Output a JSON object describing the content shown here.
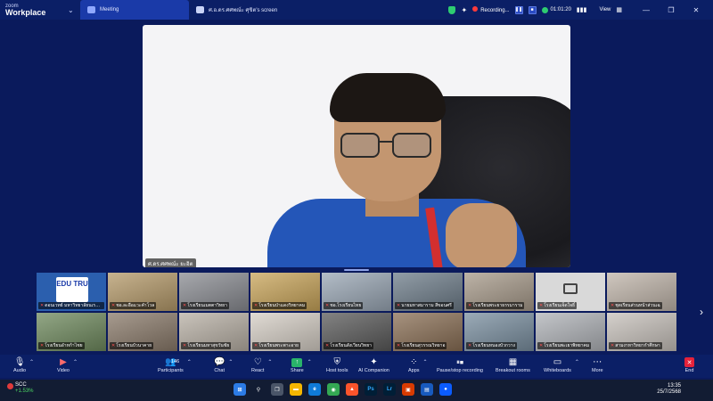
{
  "titlebar": {
    "brand_top": "zoom",
    "brand_bottom": "Workplace",
    "tabs": [
      {
        "label": "Meeting",
        "icon": "people-icon",
        "active": true
      },
      {
        "label": "ศ.อ.ดร.ศศพณ์ะ ศุขิต's screen",
        "icon": "screen-icon",
        "active": false
      }
    ],
    "recording_label": "Recording...",
    "timer": "01:01:20",
    "view_label": "View"
  },
  "shared_screen": {
    "presenter_label": "ศ.ดร.ศศพณ์ะ ยะอิต"
  },
  "gallery": {
    "tiles": [
      {
        "label": "ดอนเวทย์ มหาวิทยาลัยนเรศวร",
        "kind": "logo",
        "bg": "#2b5fae",
        "logo_text": "EDU TRU"
      },
      {
        "label": "ชอ.ละอือแวะคำโวล",
        "kind": "room",
        "bg": "#b59a6a"
      },
      {
        "label": "โรงเรียนเมตตาวิทยา",
        "kind": "room",
        "bg": "#8a8c92"
      },
      {
        "label": "โรงเรียนป่าแดงวิทยาคม",
        "kind": "room",
        "bg": "#c9a55a"
      },
      {
        "label": "ชอ.โรงเรียนไทย",
        "kind": "room",
        "bg": "#9aa7b5"
      },
      {
        "label": "นายมหาสมาราม สีขอนศรี",
        "kind": "room",
        "bg": "#6e7d8a"
      },
      {
        "label": "โรงเรียนพระยาธรรมาราม",
        "kind": "room",
        "bg": "#a79a8a"
      },
      {
        "label": "โรงเรียนเจ็ดใจธิ์",
        "kind": "camoff",
        "bg": "#d9d9d9"
      },
      {
        "label": "ชุดเรียนส่วนหน้าส่วนเฉ",
        "kind": "room",
        "bg": "#c0b5aa"
      },
      {
        "label": "โรงเรียนอำหก้าไชย",
        "kind": "room",
        "bg": "#6f8a5e"
      },
      {
        "label": "โรงเรียนบัวนาคาย",
        "kind": "room",
        "bg": "#8a7a6a"
      },
      {
        "label": "โรงเรียนมหาสุขวันชัย",
        "kind": "room",
        "bg": "#b8b0a5"
      },
      {
        "label": "โรงเรียนพระพาะอาย",
        "kind": "room",
        "bg": "#d6cfc6"
      },
      {
        "label": "โรงเรียนสังเวียนวิทยา",
        "kind": "room",
        "bg": "#5a5a5a"
      },
      {
        "label": "โรงเรียนสุวรรณวิทยาอ",
        "kind": "room",
        "bg": "#8a6f55"
      },
      {
        "label": "โรงเรียนหนองบัวกวาง",
        "kind": "room",
        "bg": "#7a8fa0"
      },
      {
        "label": "โรงเรียนพะเยาพิทยาคม",
        "kind": "room",
        "bg": "#b0b3b8"
      },
      {
        "label": "สามงาหาวิทยากำศึกษา",
        "kind": "room",
        "bg": "#c7c1bb"
      }
    ]
  },
  "toolbar": {
    "audio": "Audio",
    "video": "Video",
    "participants": "Participants",
    "participant_count": "146",
    "chat": "Chat",
    "react": "React",
    "share": "Share",
    "host_tools": "Host tools",
    "ai_companion": "AI Companion",
    "apps": "Apps",
    "pause_recording": "Pause/stop recording",
    "breakout": "Breakout rooms",
    "whiteboards": "Whiteboards",
    "more": "More",
    "end": "End"
  },
  "taskbar": {
    "stock_name": "SCC",
    "stock_change": "+1.53%",
    "time": "13:35",
    "date": "25/7/2568"
  },
  "colors": {
    "accent": "#0b1f66",
    "end_red": "#e5223a",
    "share_green": "#29b36a"
  }
}
